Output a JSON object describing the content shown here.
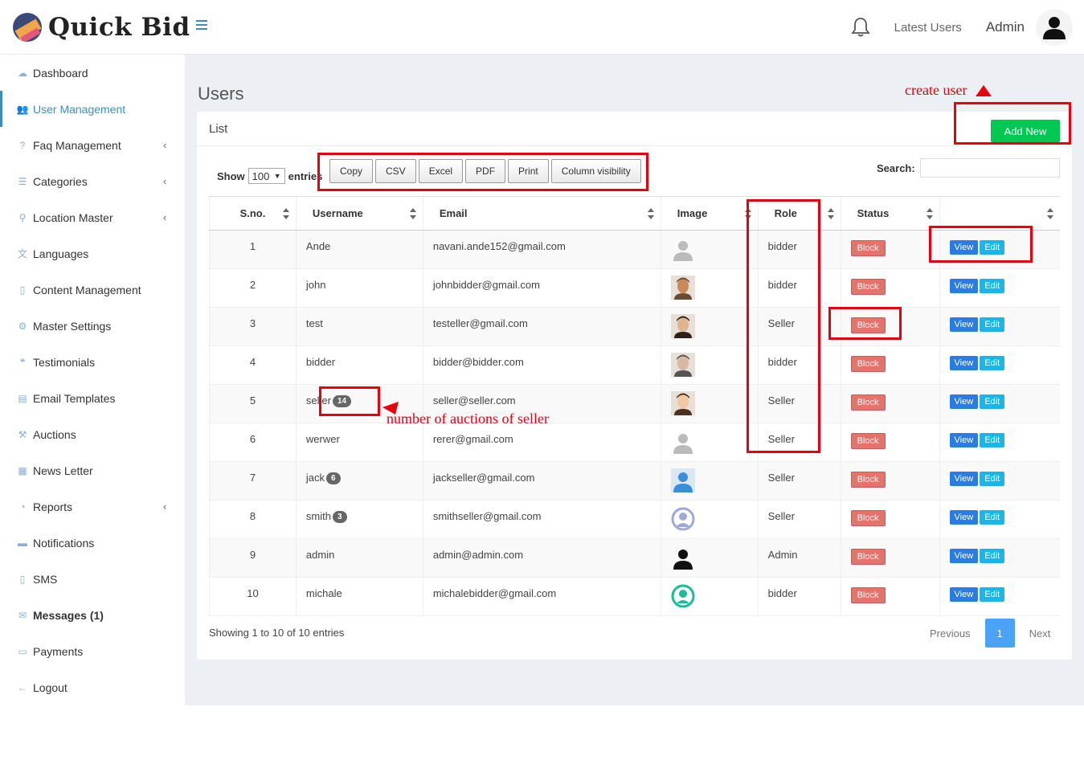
{
  "brand": {
    "name": "Quick Bid"
  },
  "topbar": {
    "latest_users": "Latest Users",
    "admin": "Admin"
  },
  "sidebar": {
    "items": [
      {
        "label": "Dashboard",
        "icon": "cloud-icon",
        "chevron": false
      },
      {
        "label": "User Management",
        "icon": "users-icon",
        "chevron": false,
        "active": true
      },
      {
        "label": "Faq Management",
        "icon": "question-icon",
        "chevron": true
      },
      {
        "label": "Categories",
        "icon": "list-icon",
        "chevron": true
      },
      {
        "label": "Location Master",
        "icon": "map-marker-icon",
        "chevron": true
      },
      {
        "label": "Languages",
        "icon": "language-icon",
        "chevron": false
      },
      {
        "label": "Content Management",
        "icon": "file-icon",
        "chevron": false
      },
      {
        "label": "Master Settings",
        "icon": "gears-icon",
        "chevron": false
      },
      {
        "label": "Testimonials",
        "icon": "quote-icon",
        "chevron": false
      },
      {
        "label": "Email Templates",
        "icon": "book-icon",
        "chevron": false
      },
      {
        "label": "Auctions",
        "icon": "gavel-icon",
        "chevron": false
      },
      {
        "label": "News Letter",
        "icon": "newspaper-icon",
        "chevron": false
      },
      {
        "label": "Reports",
        "icon": "pie-chart-icon",
        "chevron": true
      },
      {
        "label": "Notifications",
        "icon": "briefcase-icon",
        "chevron": false
      },
      {
        "label": "SMS",
        "icon": "mobile-icon",
        "chevron": false
      },
      {
        "label": "Messages (1)",
        "icon": "envelope-icon",
        "chevron": false,
        "bold": true
      },
      {
        "label": "Payments",
        "icon": "money-icon",
        "chevron": false
      },
      {
        "label": "Logout",
        "icon": "arrow-left-icon",
        "chevron": false
      }
    ]
  },
  "page": {
    "title": "Users",
    "box_title": "List",
    "add_new": "Add New"
  },
  "controls": {
    "show": "Show",
    "entries_value": "100",
    "entries": "entries",
    "buttons": [
      "Copy",
      "CSV",
      "Excel",
      "PDF",
      "Print",
      "Column visibility"
    ],
    "search": "Search:"
  },
  "table": {
    "headers": [
      "S.no.",
      "Username",
      "Email",
      "Image",
      "Role",
      "Status",
      ""
    ],
    "rows": [
      {
        "sno": "1",
        "username": "Ande",
        "badge": "",
        "email": "navani.ande152@gmail.com",
        "image": "default-avatar",
        "role": "bidder",
        "status": "Block"
      },
      {
        "sno": "2",
        "username": "john",
        "badge": "",
        "email": "johnbidder@gmail.com",
        "image": "photo-1",
        "role": "bidder",
        "status": "Block"
      },
      {
        "sno": "3",
        "username": "test",
        "badge": "",
        "email": "testeller@gmail.com",
        "image": "photo-2",
        "role": "Seller",
        "status": "Block"
      },
      {
        "sno": "4",
        "username": "bidder",
        "badge": "",
        "email": "bidder@bidder.com",
        "image": "photo-3",
        "role": "bidder",
        "status": "Block"
      },
      {
        "sno": "5",
        "username": "seller",
        "badge": "14",
        "email": "seller@seller.com",
        "image": "photo-4",
        "role": "Seller",
        "status": "Block"
      },
      {
        "sno": "6",
        "username": "werwer",
        "badge": "",
        "email": "rerer@gmail.com",
        "image": "default-avatar",
        "role": "Seller",
        "status": "Block"
      },
      {
        "sno": "7",
        "username": "jack",
        "badge": "6",
        "email": "jackseller@gmail.com",
        "image": "blue-avatar",
        "role": "Seller",
        "status": "Block"
      },
      {
        "sno": "8",
        "username": "smith",
        "badge": "3",
        "email": "smithseller@gmail.com",
        "image": "purple-avatar",
        "role": "Seller",
        "status": "Block"
      },
      {
        "sno": "9",
        "username": "admin",
        "badge": "",
        "email": "admin@admin.com",
        "image": "black-avatar",
        "role": "Admin",
        "status": "Block"
      },
      {
        "sno": "10",
        "username": "michale",
        "badge": "",
        "email": "michalebidder@gmail.com",
        "image": "teal-avatar",
        "role": "bidder",
        "status": "Block"
      }
    ],
    "view": "View",
    "edit": "Edit"
  },
  "footer": {
    "info": "Showing 1 to 10 of 10 entries",
    "previous": "Previous",
    "page": "1",
    "next": "Next"
  },
  "annotations": {
    "create_user": "create user",
    "auctions_note": "number of auctions of seller"
  },
  "colors": {
    "accent": "#3c8dbc",
    "add": "#00c853",
    "block": "#e4736b",
    "view": "#2a7ce0",
    "edit": "#18b7e8",
    "highlight": "#e8000f"
  }
}
